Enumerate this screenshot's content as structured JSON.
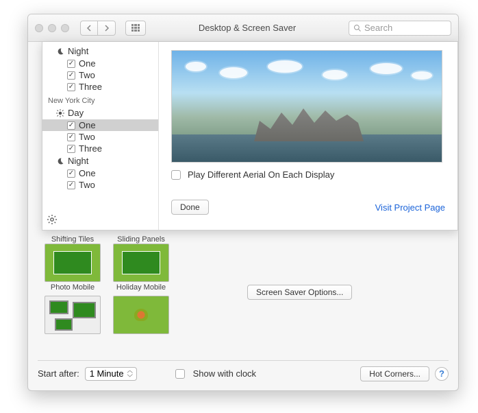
{
  "window": {
    "title": "Desktop & Screen Saver",
    "search_placeholder": "Search"
  },
  "sheet": {
    "groups": [
      {
        "name": "",
        "sections": [
          {
            "icon": "moon",
            "label": "Night",
            "items": [
              {
                "label": "One",
                "checked": true
              },
              {
                "label": "Two",
                "checked": true
              },
              {
                "label": "Three",
                "checked": true
              }
            ]
          }
        ]
      },
      {
        "name": "New York City",
        "sections": [
          {
            "icon": "sun",
            "label": "Day",
            "items": [
              {
                "label": "One",
                "checked": true,
                "selected": true
              },
              {
                "label": "Two",
                "checked": true
              },
              {
                "label": "Three",
                "checked": true
              }
            ]
          },
          {
            "icon": "moon",
            "label": "Night",
            "items": [
              {
                "label": "One",
                "checked": true
              },
              {
                "label": "Two",
                "checked": true
              }
            ]
          }
        ]
      }
    ],
    "play_different": {
      "label": "Play Different Aerial On Each Display",
      "checked": false
    },
    "done": "Done",
    "visit": "Visit Project Page"
  },
  "savers": {
    "row1": [
      {
        "label": "Shifting Tiles"
      },
      {
        "label": "Sliding Panels"
      }
    ],
    "row2": [
      {
        "label": "Photo Mobile"
      },
      {
        "label": "Holiday Mobile"
      }
    ]
  },
  "options_button": "Screen Saver Options...",
  "bottom": {
    "start_after_label": "Start after:",
    "start_after_value": "1 Minute",
    "show_clock": {
      "label": "Show with clock",
      "checked": false
    },
    "hot_corners": "Hot Corners..."
  }
}
